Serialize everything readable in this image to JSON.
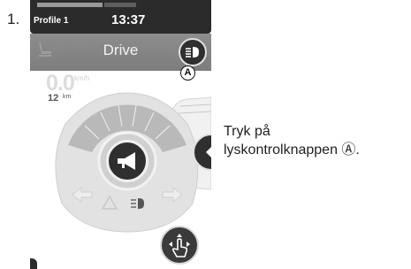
{
  "step": {
    "number": "1."
  },
  "status_bar": {
    "profile": "Profile 1",
    "clock": "13:37"
  },
  "mode": {
    "title": "Drive"
  },
  "speed": {
    "value": "0.0",
    "unit": "km/h"
  },
  "odometer": {
    "value": "12",
    "unit": "km"
  },
  "marker": {
    "label": "A"
  },
  "instruction": {
    "line1": "Tryk på",
    "line2": "lyskontrolknappen Ⓐ."
  },
  "icons": {
    "seat": "seat-icon",
    "light": "headlight-icon",
    "horn": "horn-icon",
    "left_arrow": "left-arrow-icon",
    "right_arrow": "right-arrow-icon",
    "hazard": "hazard-icon",
    "touch": "touch-control-icon"
  },
  "colors": {
    "status_bar": "#2b2b2b",
    "mode_bar": "#888888",
    "button_dark": "#2f2f2f"
  }
}
